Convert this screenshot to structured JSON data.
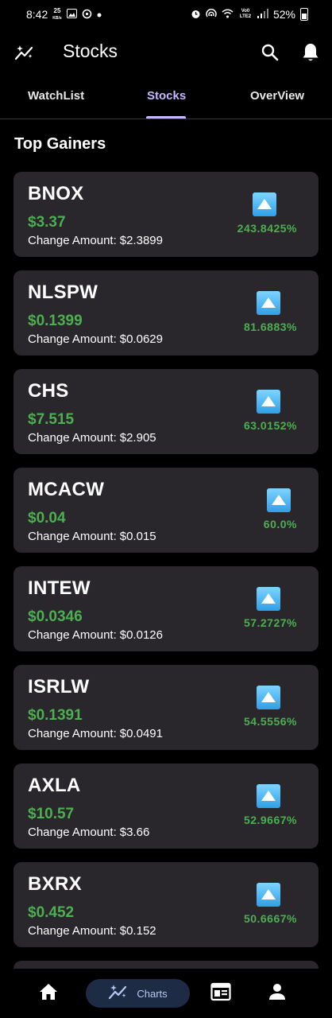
{
  "status_bar": {
    "time": "8:42",
    "speed": "25",
    "speed_unit": "KB/s",
    "network": "Vo0 LTE2",
    "battery": "52%"
  },
  "app_bar": {
    "title": "Stocks"
  },
  "tabs": [
    {
      "label": "WatchList",
      "active": false
    },
    {
      "label": "Stocks",
      "active": true
    },
    {
      "label": "OverView",
      "active": false
    }
  ],
  "section": {
    "title": "Top Gainers"
  },
  "change_label": "Change Amount:",
  "stocks": [
    {
      "symbol": "BNOX",
      "price": "$3.37",
      "change": "$2.3899",
      "percent": "243.8425%"
    },
    {
      "symbol": "NLSPW",
      "price": "$0.1399",
      "change": "$0.0629",
      "percent": "81.6883%"
    },
    {
      "symbol": "CHS",
      "price": "$7.515",
      "change": "$2.905",
      "percent": "63.0152%"
    },
    {
      "symbol": "MCACW",
      "price": "$0.04",
      "change": "$0.015",
      "percent": "60.0%"
    },
    {
      "symbol": "INTEW",
      "price": "$0.0346",
      "change": "$0.0126",
      "percent": "57.2727%"
    },
    {
      "symbol": "ISRLW",
      "price": "$0.1391",
      "change": "$0.0491",
      "percent": "54.5556%"
    },
    {
      "symbol": "AXLA",
      "price": "$10.57",
      "change": "$3.66",
      "percent": "52.9667%"
    },
    {
      "symbol": "BXRX",
      "price": "$0.452",
      "change": "$0.152",
      "percent": "50.6667%"
    }
  ],
  "bottom_nav": {
    "items": [
      {
        "icon": "home-icon"
      },
      {
        "icon": "charts-icon",
        "label": "Charts",
        "active": true
      },
      {
        "icon": "news-icon"
      },
      {
        "icon": "profile-icon"
      }
    ]
  },
  "colors": {
    "background": "#000000",
    "card": "#29272b",
    "gain": "#4caf50",
    "accent": "#c8b7ff",
    "nav_active_bg": "#1d2b44"
  }
}
